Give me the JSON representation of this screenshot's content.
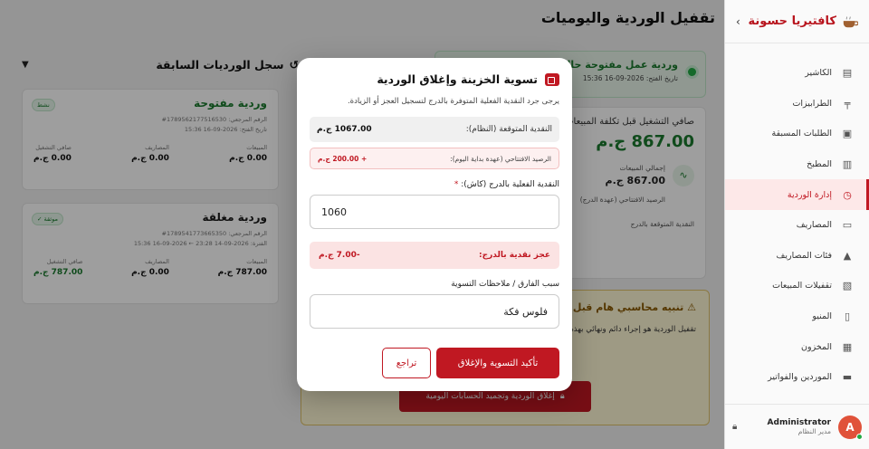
{
  "sidebar": {
    "brand": "كافتيريا حسونة",
    "items": [
      {
        "label": "الكاشير",
        "icon": "cash-register-icon"
      },
      {
        "label": "الطرابيزات",
        "icon": "table-icon"
      },
      {
        "label": "الطلبات المسبقة",
        "icon": "clipboard-icon"
      },
      {
        "label": "المطبخ",
        "icon": "kitchen-icon"
      },
      {
        "label": "إدارة الوردية",
        "icon": "clock-icon",
        "active": true
      },
      {
        "label": "المصاريف",
        "icon": "wallet-icon"
      },
      {
        "label": "فئات المصاريف",
        "icon": "categories-icon"
      },
      {
        "label": "تقفيلات المبيعات",
        "icon": "report-icon"
      },
      {
        "label": "المنيو",
        "icon": "book-icon"
      },
      {
        "label": "المخزون",
        "icon": "archive-icon"
      },
      {
        "label": "الموردين والفواتير",
        "icon": "truck-icon"
      }
    ],
    "user": {
      "name": "Administrator",
      "role": "مدير النظام",
      "initial": "A"
    }
  },
  "page": {
    "title": "تقفيل الوردية واليوميات"
  },
  "history": {
    "title": "سجل الورديات السابقة",
    "shifts": [
      {
        "name": "وردية مفتوحة",
        "badge": "نشط",
        "ref": "الرقم المرجعي: 1789562177516530#",
        "date": "تاريخ الفتح: 2026-09-16 15:36",
        "sales_label": "المبيعات",
        "sales": "0.00 ج.م",
        "expenses_label": "المصاريف",
        "expenses": "0.00 ج.م",
        "net_label": "صافي التشغيل",
        "net": "0.00 ج.م"
      },
      {
        "name": "وردية مغلقة",
        "badge": "موثقة ✓",
        "ref": "الرقم المرجعي: 1789541773665350#",
        "date": "الفترة: 2026-09-14 23:28 ← 2026-09-16 15:36",
        "sales_label": "المبيعات",
        "sales": "787.00 ج.م",
        "expenses_label": "المصاريف",
        "expenses": "0.00 ج.م",
        "net_label": "صافي التشغيل",
        "net": "787.00 ج.م"
      }
    ]
  },
  "open_banner": {
    "title": "وردية عمل مفتوحة حاليا",
    "date": "تاريخ الفتح: 2026-09-16 15:36"
  },
  "net_card": {
    "label": "صافي التشغيل قبل تكلفة المبيعات",
    "value": "867.00 ج.م",
    "total_sales_label": "إجمالي المبيعات",
    "total_sales": "867.00 ج.م",
    "opening_label": "الرصيد الافتتاحي (عهدة الدرج)",
    "expected_label": "النقدية المتوقعة بالدرج"
  },
  "warning": {
    "title": "تنبيه محاسبي هام قبل",
    "body": "تقفيل الوردية هو إجراء دائم ونهائي بهذه الوردية وأرشفتها نهائيا. وسيتم مطابقات الباقي قبل إتمام الإغلاق",
    "button": "إغلاق الوردية وتجميد الحسابات اليومية"
  },
  "modal": {
    "title": "تسوية الخزينة وإغلاق الوردية",
    "description": "يرجى جرد النقدية الفعلية المتوفرة بالدرج لتسجيل العجز أو الزيادة.",
    "expected_label": "النقدية المتوقعة (النظام):",
    "expected_value": "1067.00 ج.م",
    "opening_label": "الرصيد الافتتاحي (عهدة بداية اليوم):",
    "opening_value": "+ 200.00 ج.م",
    "actual_label": "النقدية الفعلية بالدرج (كاش):",
    "actual_required": "*",
    "actual_value": "1060",
    "deficit_label": "عجز نقدية بالدرج:",
    "deficit_value": "-7.00 ج.م",
    "notes_label": "سبب الفارق / ملاحظات التسوية",
    "notes_value": "فلوس فكة",
    "confirm_button": "تأكيد التسوية والإغلاق",
    "back_button": "تراجع"
  },
  "colors": {
    "accent": "#c01822",
    "success": "#1a7a2e"
  }
}
